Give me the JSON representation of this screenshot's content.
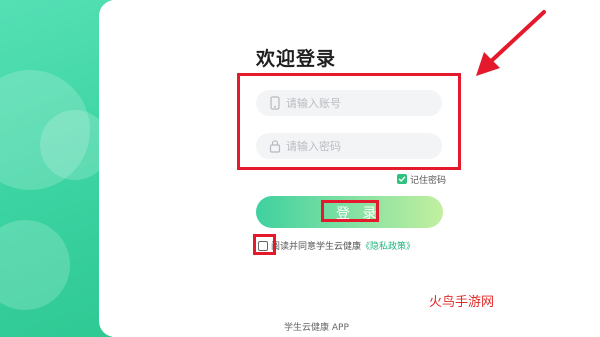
{
  "login": {
    "title": "欢迎登录",
    "account_placeholder": "请输入账号",
    "password_placeholder": "请输入密码",
    "remember_label": "记住密码",
    "remember_checked": true,
    "submit_label": "登 录",
    "agreement_text": "阅读并同意学生云健康",
    "privacy_link": "《隐私政策》",
    "agreement_checked": false
  },
  "watermark": "火鸟手游网",
  "footer": "学生云健康 APP",
  "colors": {
    "accent": "#2ec27e",
    "highlight_red": "#e5192c"
  },
  "icons": [
    "phone-icon",
    "lock-icon",
    "check-icon",
    "arrow-icon"
  ]
}
